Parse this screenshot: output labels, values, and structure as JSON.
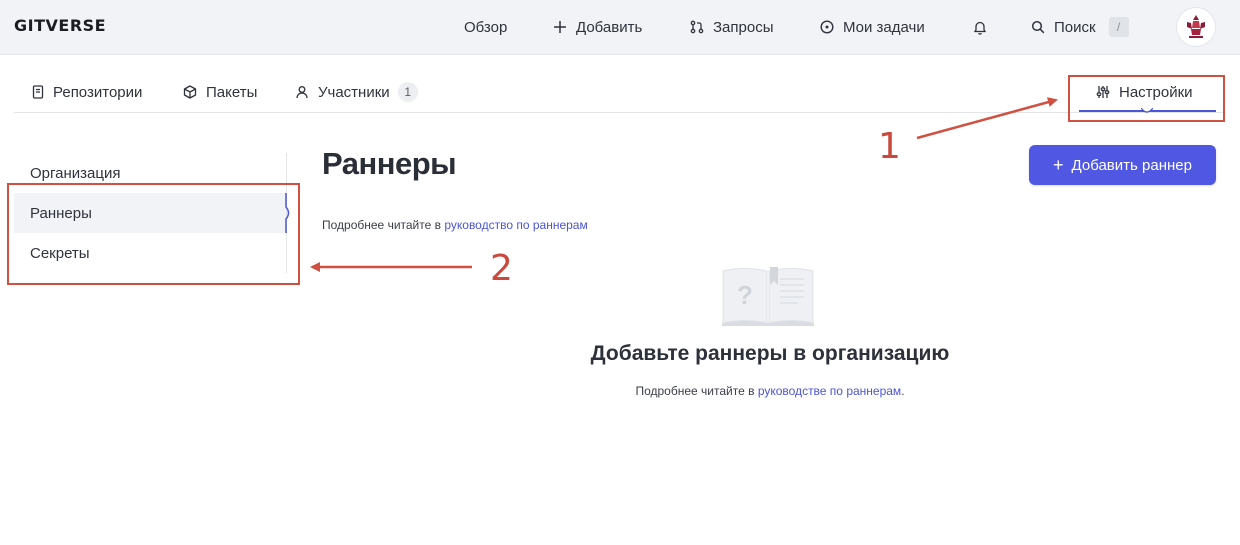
{
  "header": {
    "logo": "GITVERSE",
    "nav": {
      "overview": "Обзор",
      "add": "Добавить",
      "requests": "Запросы",
      "my_tasks": "Мои задачи",
      "search": "Поиск",
      "search_shortcut": "/"
    }
  },
  "tabs": {
    "repositories": "Репозитории",
    "packages": "Пакеты",
    "members": "Участники",
    "members_count": "1",
    "settings": "Настройки"
  },
  "sidebar": {
    "items": [
      "Организация",
      "Раннеры",
      "Секреты"
    ],
    "active_index": 1
  },
  "main": {
    "title": "Раннеры",
    "add_button": "Добавить раннер",
    "hint_prefix": "Подробнее читайте в ",
    "hint_link": "руководство по раннерам",
    "empty_title": "Добавьте раннеры в организацию",
    "empty_hint_prefix": "Подробнее читайте в ",
    "empty_hint_link": "руководстве по раннерам",
    "empty_hint_suffix": "."
  },
  "annotations": {
    "label_1": "1",
    "label_2": "2"
  },
  "colors": {
    "accent": "#4f57e3",
    "link": "#4b55d6",
    "annotation": "#d05042"
  }
}
